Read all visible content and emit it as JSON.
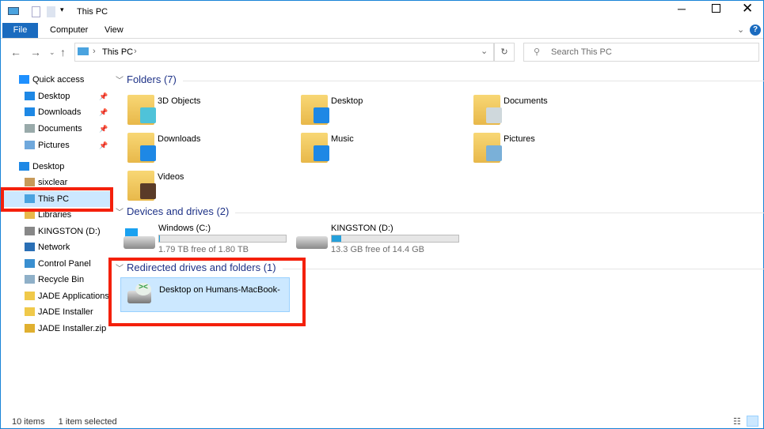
{
  "window": {
    "title": "This PC",
    "file_tab": "File",
    "tabs": [
      "Computer",
      "View"
    ]
  },
  "address": {
    "crumb": "This PC",
    "search_placeholder": "Search This PC"
  },
  "sidebar": {
    "items": [
      {
        "label": "Quick access",
        "color": "#1e90ff"
      },
      {
        "label": "Desktop",
        "pinned": true,
        "color": "#1e88e5"
      },
      {
        "label": "Downloads",
        "pinned": true,
        "color": "#1e88e5"
      },
      {
        "label": "Documents",
        "pinned": true,
        "color": "#9aa"
      },
      {
        "label": "Pictures",
        "pinned": true,
        "color": "#6fa8dc"
      },
      {
        "label": "Desktop",
        "color": "#1e88e5"
      },
      {
        "label": "sixclear",
        "color": "#c79a5a"
      },
      {
        "label": "This PC",
        "color": "#4aa3df",
        "selected": true
      },
      {
        "label": "Libraries",
        "color": "#e8b84a"
      },
      {
        "label": "KINGSTON (D:)",
        "color": "#888"
      },
      {
        "label": "Network",
        "color": "#2a6fb5"
      },
      {
        "label": "Control Panel",
        "color": "#3a8fd0"
      },
      {
        "label": "Recycle Bin",
        "color": "#8fb0c8"
      },
      {
        "label": "JADE Applications",
        "color": "#f0c94a"
      },
      {
        "label": "JADE Installer",
        "color": "#f0c94a"
      },
      {
        "label": "JADE Installer.zip",
        "color": "#e0b030"
      }
    ]
  },
  "groups": {
    "folders": "Folders (7)",
    "devices": "Devices and drives (2)",
    "redirected": "Redirected drives and folders (1)"
  },
  "folders": [
    {
      "label": "3D Objects",
      "color": "#4fc3d9"
    },
    {
      "label": "Desktop",
      "color": "#1e88e5"
    },
    {
      "label": "Documents",
      "color": "#cfd8dc"
    },
    {
      "label": "Downloads",
      "color": "#1e88e5"
    },
    {
      "label": "Music",
      "color": "#1e88e5"
    },
    {
      "label": "Pictures",
      "color": "#7ab0d8"
    },
    {
      "label": "Videos",
      "color": "#5a3b28"
    }
  ],
  "drives": [
    {
      "name": "Windows (C:)",
      "free": "1.79 TB free of 1.80 TB",
      "used_fraction": 0.006
    },
    {
      "name": "KINGSTON (D:)",
      "free": "13.3 GB free of 14.4 GB",
      "used_fraction": 0.076
    }
  ],
  "redirected": {
    "label": "Desktop on Humans-MacBook-"
  },
  "status": {
    "items": "10 items",
    "selected": "1 item selected"
  }
}
